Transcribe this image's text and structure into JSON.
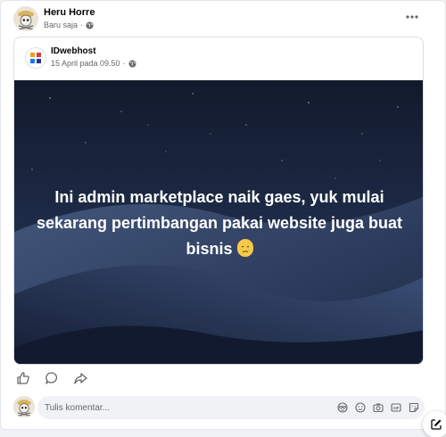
{
  "post": {
    "author": "Heru Horre",
    "timestamp": "Baru saja",
    "privacy_icon": "globe-icon",
    "more_icon": "more-horizontal-icon"
  },
  "shared": {
    "page_name": "IDwebhost",
    "date": "15 April pada 09.50",
    "privacy_icon": "globe-icon",
    "image_text": "Ini admin marketplace naik gaes, yuk mulai sekarang pertimbangan pakai website juga buat bisnis",
    "emoji": "face-with-tear-emoji"
  },
  "actions": [
    {
      "icon": "like-icon"
    },
    {
      "icon": "comment-icon"
    },
    {
      "icon": "share-icon"
    }
  ],
  "comment": {
    "placeholder": "Tulis komentar...",
    "tools": [
      "avatar-sticker-icon",
      "emoji-icon",
      "camera-icon",
      "gif-icon",
      "sticker-icon"
    ]
  },
  "colors": {
    "text_secondary": "#65676b",
    "image_bg": "#1d2944",
    "logo_blue": "#1877f2",
    "logo_red": "#e03a3a",
    "logo_orange": "#f39c1c"
  }
}
